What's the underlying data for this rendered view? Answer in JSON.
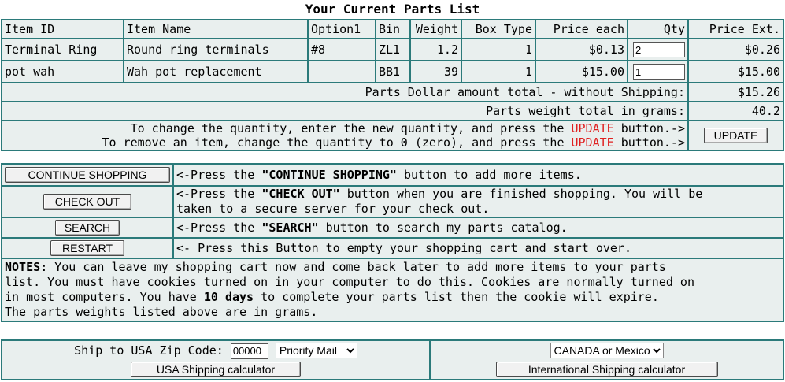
{
  "title": "Your Current Parts List",
  "headers": [
    "Item ID",
    "Item Name",
    "Option1",
    "Bin",
    "Weight",
    "Box Type",
    "Price each",
    "Qty",
    "Price Ext."
  ],
  "rows": [
    {
      "id": "Terminal Ring",
      "name": "Round ring terminals",
      "option": "#8",
      "bin": "ZL1",
      "weight": "1.2",
      "box": "1",
      "price": "$0.13",
      "qty": "2",
      "ext": "$0.26"
    },
    {
      "id": "pot wah",
      "name": "Wah pot replacement",
      "option": "",
      "bin": "BB1",
      "weight": "39",
      "box": "1",
      "price": "$15.00",
      "qty": "1",
      "ext": "$15.00"
    }
  ],
  "totals": {
    "dollar_label": "Parts Dollar amount total - without Shipping:",
    "dollar_value": "$15.26",
    "weight_label": "Parts weight total in grams:",
    "weight_value": "40.2"
  },
  "update": {
    "line1_a": "To change the quantity, enter the new quantity, and press the ",
    "line1_b": "UPDATE",
    "line1_c": " button.->",
    "line2_a": "To remove an item, change the quantity to 0 (zero), and press the ",
    "line2_b": "UPDATE",
    "line2_c": " button.->",
    "button": "UPDATE"
  },
  "actions": {
    "continue": {
      "button": "CONTINUE SHOPPING",
      "pre": "<-Press the ",
      "bold": "\"CONTINUE SHOPPING\"",
      "post": " button to add more items."
    },
    "checkout": {
      "button": "CHECK OUT",
      "pre": "<-Press the ",
      "bold": "\"CHECK OUT\"",
      "post": " button when you are finished shopping. You will be",
      "post2": "taken to a secure server for your check out."
    },
    "search": {
      "button": "SEARCH",
      "pre": "<-Press the ",
      "bold": "\"SEARCH\"",
      "post": " button to search my parts catalog."
    },
    "restart": {
      "button": "RESTART",
      "text": "<- Press this Button to empty your shopping cart and start over."
    }
  },
  "notes": {
    "label": "NOTES:",
    "line1": " You can leave my shopping cart now and come back later to add more items to your parts",
    "line2": "list. You must have cookies turned on in your computer to do this. Cookies are normally turned on",
    "line3a": "in most computers. You have ",
    "line3b": "10 days",
    "line3c": " to complete your parts list then the cookie will expire.",
    "line4": "The parts weights listed above are in grams."
  },
  "shipping": {
    "zip_label": "Ship to USA Zip Code:",
    "zip_value": "00000",
    "usa_method": "Priority Mail",
    "usa_button": "USA Shipping calculator",
    "intl_region": "CANADA or Mexico",
    "intl_button": "International Shipping calculator"
  },
  "colors": {
    "border": "#2b7a7a",
    "cell_bg": "#e9efee",
    "accent_red": "#e02020"
  }
}
